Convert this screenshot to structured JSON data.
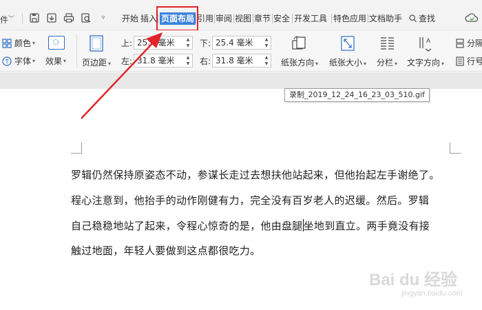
{
  "menubar": {
    "file_fragment": "件",
    "tabs": [
      {
        "label": "开始"
      },
      {
        "label": "插入"
      },
      {
        "label": "页面布局",
        "active": true
      },
      {
        "label": "引用"
      },
      {
        "label": "审阅"
      },
      {
        "label": "视图"
      },
      {
        "label": "章节"
      },
      {
        "label": "安全"
      },
      {
        "label": "开发工具"
      },
      {
        "label": "特色应用"
      },
      {
        "label": "文档助手"
      }
    ],
    "search_label": "查找"
  },
  "ribbon": {
    "color_label": "颜色",
    "font_label": "字体",
    "effect_label": "效果",
    "margins_label": "页边距",
    "top_label": "上:",
    "top_value": "25.4 毫米",
    "bottom_label": "下:",
    "bottom_value": "25.4 毫米",
    "left_label": "左:",
    "left_value": "31.8 毫米",
    "right_label": "右:",
    "right_value": "31.8 毫米",
    "orientation_label": "纸张方向",
    "size_label": "纸张大小",
    "columns_label": "分栏",
    "text_direction_label": "文字方向",
    "break_label": "分隔",
    "line_number_label": "行号"
  },
  "tooltip": "录制_2019_12_24_16_23_03_510.gif",
  "document": {
    "line1": "罗辑仍然保持原姿态不动，参谋长走过去想扶他站起来，但他抬起左手谢绝了。",
    "line2": "程心注意到，他抬手的动作刚健有力，完全没有百岁老人的迟缓。然后。罗辑",
    "line3a": "自己稳稳地站了起来，令程心惊奇的是，他由盘腿",
    "line3b": "坐地到直立。两手竟没有接",
    "line4": "触过地面，年轻人要做到这点都很吃力。"
  },
  "watermark": {
    "main": "Bai du 经验",
    "sub": "jingyan.baidu.com"
  },
  "colors": {
    "active_tab": "#3d83dd",
    "highlight": "#e0242a"
  }
}
